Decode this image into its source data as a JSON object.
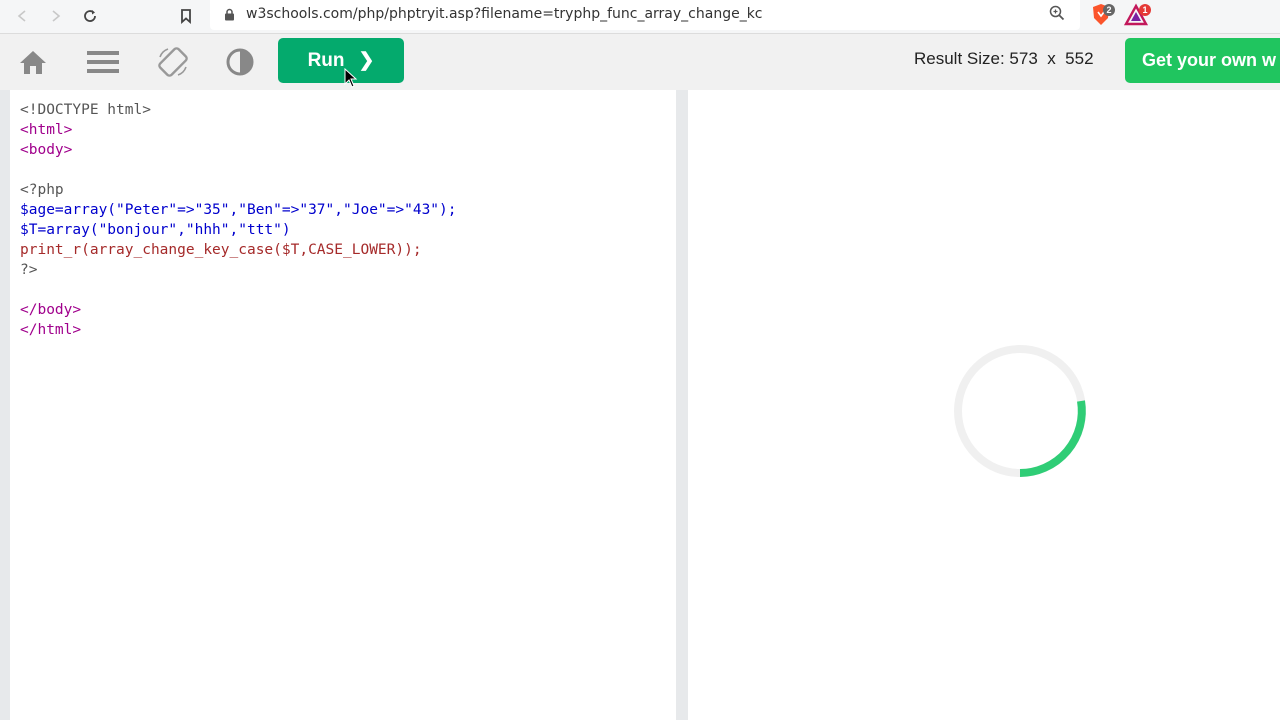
{
  "browser": {
    "url": "w3schools.com/php/phptryit.asp?filename=tryphp_func_array_change_kc",
    "brave_badge": "2",
    "alert_badge": "1",
    "icons": [
      "back-icon",
      "forward-icon",
      "reload-icon",
      "bookmark-icon",
      "lock-icon",
      "zoom-icon",
      "brave-shield-icon",
      "brave-rewards-icon"
    ]
  },
  "toolbar": {
    "run_label": "Run",
    "run_arrow": "❯",
    "result_size_label": "Result Size: 573  x  552",
    "get_own_label": "Get your own w",
    "icons": [
      "home-icon",
      "menu-icon",
      "rotate-icon",
      "theme-icon"
    ]
  },
  "editor": {
    "lines": [
      "<!DOCTYPE html>",
      "<html>",
      "<body>",
      "",
      "<?php",
      "$age=array(\"Peter\"=>\"35\",\"Ben\"=>\"37\",\"Joe\"=>\"43\");",
      "$T=array(\"bonjour\",\"hhh\",\"ttt\")",
      "print_r(array_change_key_case($T,CASE_LOWER));",
      "?>",
      "",
      "</body>",
      "</html>"
    ]
  },
  "colors": {
    "run_green": "#04aa6d",
    "spinner_green": "#2fcd76",
    "tag_purple": "#a0008c"
  }
}
